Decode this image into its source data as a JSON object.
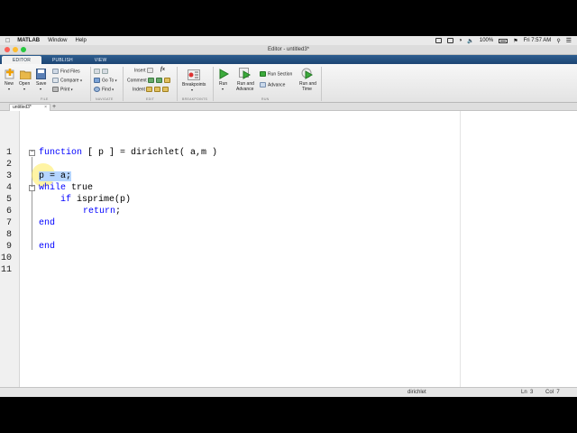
{
  "menubar": {
    "app": "MATLAB",
    "items": [
      "Window",
      "Help"
    ],
    "battery": "100%",
    "clock": "Fri 7:57 AM"
  },
  "window": {
    "title": "Editor - untitled3*"
  },
  "toolstrip": {
    "tabs": [
      "EDITOR",
      "PUBLISH",
      "VIEW"
    ],
    "file": {
      "new": "New",
      "open": "Open",
      "save": "Save",
      "find_files": "Find Files",
      "compare": "Compare",
      "print": "Print",
      "label": "FILE"
    },
    "navigate": {
      "go_to": "Go To",
      "find": "Find",
      "label": "NAVIGATE"
    },
    "edit": {
      "insert": "Insert",
      "fx": "fx",
      "comment": "Comment",
      "indent": "Indent",
      "label": "EDIT"
    },
    "breakpoints": {
      "breakpoints": "Breakpoints",
      "label": "BREAKPOINTS"
    },
    "run": {
      "run": "Run",
      "run_and_advance_1": "Run and",
      "run_and_advance_2": "Advance",
      "run_section": "Run Section",
      "advance": "Advance",
      "run_and_time_1": "Run and",
      "run_and_time_2": "Time",
      "label": "RUN"
    },
    "accent_color": "#1d4573"
  },
  "editor": {
    "file_tab": "untitled3*",
    "add_tab": "+",
    "line_numbers": [
      "1",
      "2",
      "3",
      "4",
      "5",
      "6",
      "7",
      "8",
      "9",
      "10",
      "11"
    ],
    "code": {
      "l1_kw": "function",
      "l1_rest": " [ p ] = dirichlet( a,m )",
      "l3_text": "p = a;",
      "l4_kw": "while",
      "l4_rest": " true",
      "l5_kw": "if",
      "l5_rest": " isprime(p)",
      "l6_kw": "return",
      "l6_rest": ";",
      "l7_kw": "end",
      "l9_kw": "end"
    },
    "keyword_color": "#0000ff"
  },
  "status": {
    "function_name": "dirichlet",
    "ln_label": "Ln",
    "ln_value": "3",
    "col_label": "Col",
    "col_value": "7"
  }
}
